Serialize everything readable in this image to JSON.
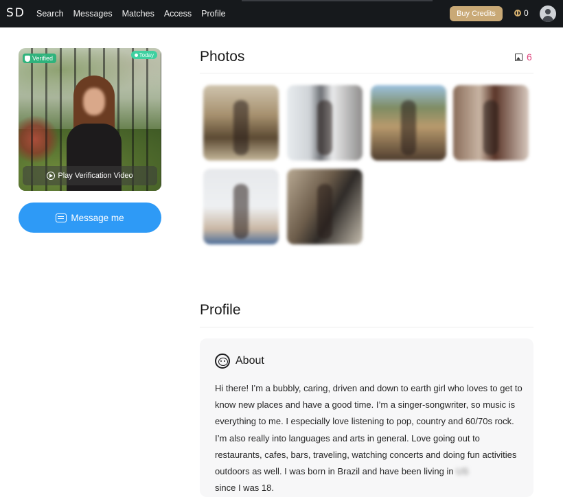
{
  "nav": {
    "logo": "SD",
    "links": [
      "Search",
      "Messages",
      "Matches",
      "Access",
      "Profile"
    ],
    "buy_credits": "Buy Credits",
    "credits": "0"
  },
  "profile_card": {
    "verified_badge": "Verified",
    "today_badge": "Today",
    "play_video": "Play Verification Video",
    "message_button": "Message me"
  },
  "photos": {
    "title": "Photos",
    "count": "6"
  },
  "profile_section": {
    "title": "Profile",
    "about_title": "About",
    "about_text": "Hi there! I’m a bubbly, caring, driven and down to earth girl who loves to get to know new places and have a good time. I’m a singer-songwriter, so music is everything to me. I especially love listening to pop, country and 60/70s rock. I’m also really into languages and arts in general. Love going out to restaurants, cafes, bars, traveling, watching concerts and doing fun activities outdoors as well. I was born in Brazil and have been living in",
    "about_text_hidden": "US",
    "about_text_tail": "since I was 18."
  },
  "colors": {
    "nav_bg": "#16191c",
    "buy_credits": "#c9a976",
    "message_button": "#2e9af6",
    "photo_count": "#e0477f",
    "verified": "#2fb37c"
  }
}
